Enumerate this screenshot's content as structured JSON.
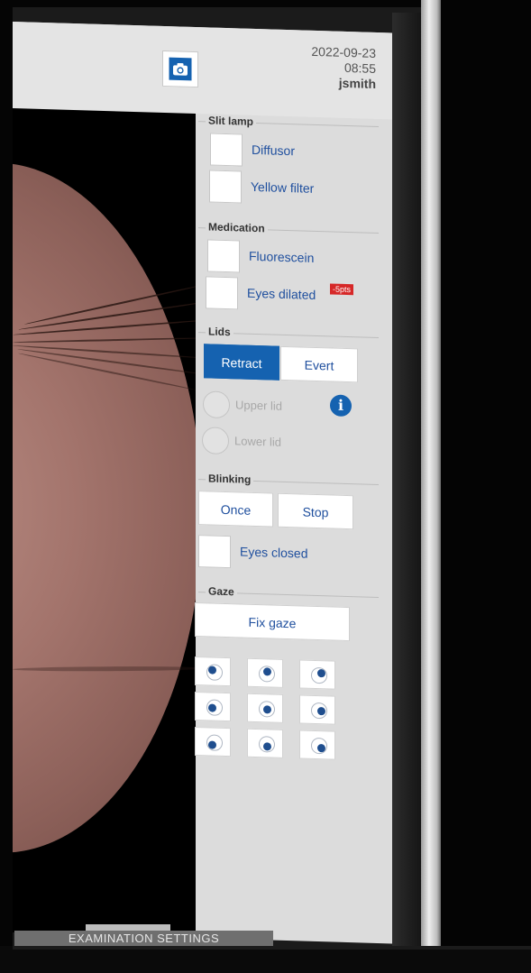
{
  "header": {
    "date": "2022-09-23",
    "time": "08:55",
    "user": "jsmith",
    "camera_icon": "camera-icon"
  },
  "panel": {
    "slit_lamp": {
      "title": "Slit lamp",
      "diffusor": "Diffusor",
      "yellow_filter": "Yellow filter"
    },
    "medication": {
      "title": "Medication",
      "fluorescein": "Fluorescein",
      "eyes_dilated": "Eyes dilated",
      "penalty": "-5pts"
    },
    "lids": {
      "title": "Lids",
      "retract": "Retract",
      "evert": "Evert",
      "upper_lid": "Upper lid",
      "lower_lid": "Lower lid",
      "info_icon": "info-icon",
      "active_mode": "Retract"
    },
    "blinking": {
      "title": "Blinking",
      "once": "Once",
      "stop": "Stop",
      "eyes_closed": "Eyes closed"
    },
    "gaze": {
      "title": "Gaze",
      "fix_gaze": "Fix gaze",
      "grid_directions": [
        "up-left",
        "up",
        "up-right",
        "left",
        "center",
        "right",
        "down-left",
        "down",
        "down-right"
      ]
    }
  },
  "footer": {
    "tab_label": "EXAMINATION SETTINGS"
  },
  "colors": {
    "accent": "#1562b0",
    "label_blue": "#1f4f9e",
    "badge_red": "#d62828"
  }
}
